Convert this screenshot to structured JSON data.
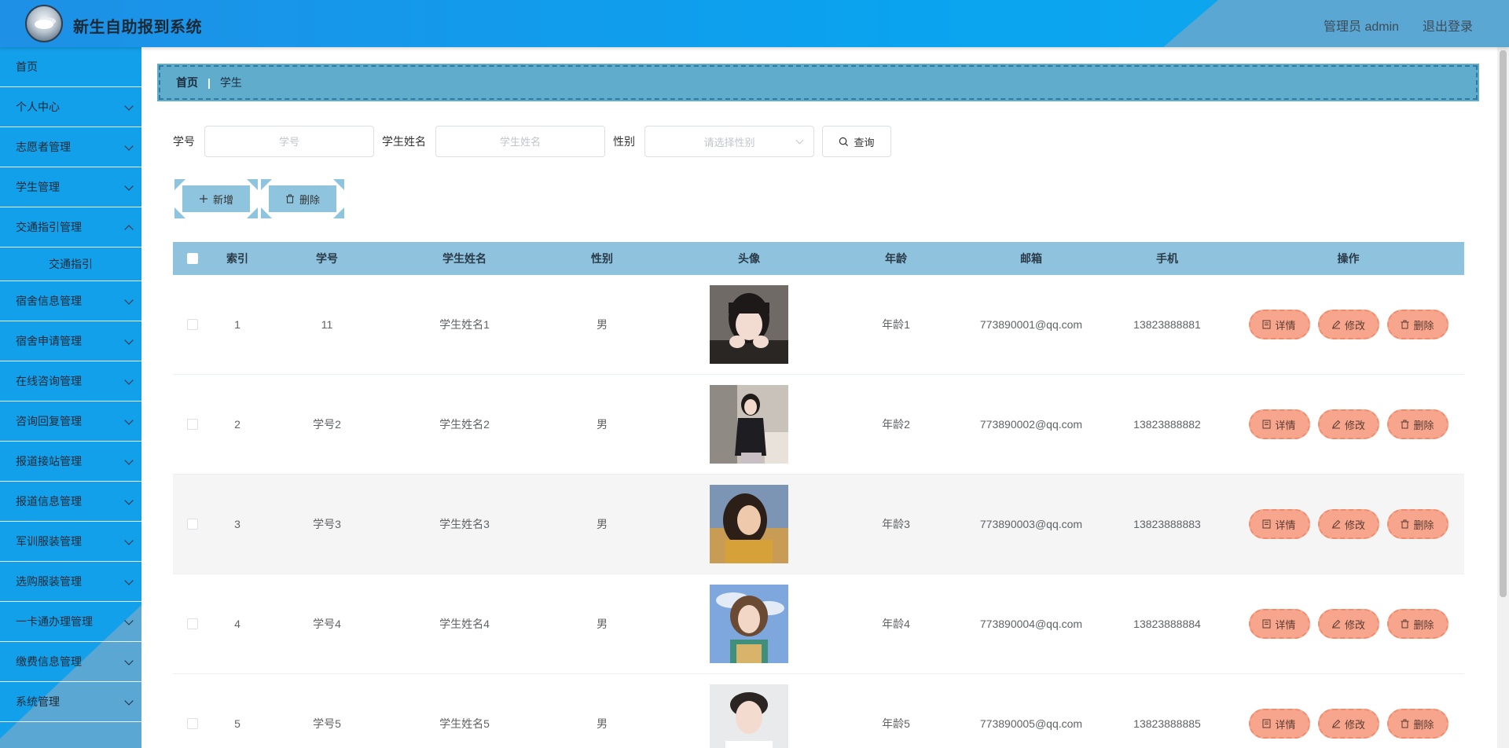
{
  "header": {
    "title": "新生自助报到系统",
    "admin": "管理员 admin",
    "logout": "退出登录"
  },
  "sidebar": {
    "items": [
      {
        "label": "首页"
      },
      {
        "label": "个人中心"
      },
      {
        "label": "志愿者管理"
      },
      {
        "label": "学生管理"
      },
      {
        "label": "交通指引管理"
      },
      {
        "label": "交通指引"
      },
      {
        "label": "宿舍信息管理"
      },
      {
        "label": "宿舍申请管理"
      },
      {
        "label": "在线咨询管理"
      },
      {
        "label": "咨询回复管理"
      },
      {
        "label": "报道接站管理"
      },
      {
        "label": "报道信息管理"
      },
      {
        "label": "军训服装管理"
      },
      {
        "label": "选购服装管理"
      },
      {
        "label": "一卡通办理管理"
      },
      {
        "label": "缴费信息管理"
      },
      {
        "label": "系统管理"
      }
    ]
  },
  "breadcrumb": {
    "home": "首页",
    "separator": "|",
    "current": "学生"
  },
  "search": {
    "no_label": "学号",
    "no_placeholder": "学号",
    "name_label": "学生姓名",
    "name_placeholder": "学生姓名",
    "sex_label": "性别",
    "sex_placeholder": "请选择性别",
    "query_label": "查询"
  },
  "actions": {
    "add_label": "新增",
    "delete_label": "删除"
  },
  "table": {
    "headers": [
      "索引",
      "学号",
      "学生姓名",
      "性别",
      "头像",
      "年龄",
      "邮箱",
      "手机",
      "操作"
    ],
    "rows": [
      {
        "index": "1",
        "no": "11",
        "name": "学生姓名1",
        "sex": "男",
        "age": "年龄1",
        "email": "773890001@qq.com",
        "phone": "13823888881"
      },
      {
        "index": "2",
        "no": "学号2",
        "name": "学生姓名2",
        "sex": "男",
        "age": "年龄2",
        "email": "773890002@qq.com",
        "phone": "13823888882"
      },
      {
        "index": "3",
        "no": "学号3",
        "name": "学生姓名3",
        "sex": "男",
        "age": "年龄3",
        "email": "773890003@qq.com",
        "phone": "13823888883"
      },
      {
        "index": "4",
        "no": "学号4",
        "name": "学生姓名4",
        "sex": "男",
        "age": "年龄4",
        "email": "773890004@qq.com",
        "phone": "13823888884"
      },
      {
        "index": "5",
        "no": "学号5",
        "name": "学生姓名5",
        "sex": "男",
        "age": "年龄5",
        "email": "773890005@qq.com",
        "phone": "13823888885"
      }
    ],
    "ops": {
      "detail": "详情",
      "edit": "修改",
      "delete": "删除"
    }
  },
  "colors": {
    "header_blue": "#1e90e6",
    "sidebar_blue": "#13a0ea",
    "breadcrumb_bg": "#5faccd",
    "table_head_bg": "#8ec2dd",
    "op_button": "#f7a58c"
  }
}
